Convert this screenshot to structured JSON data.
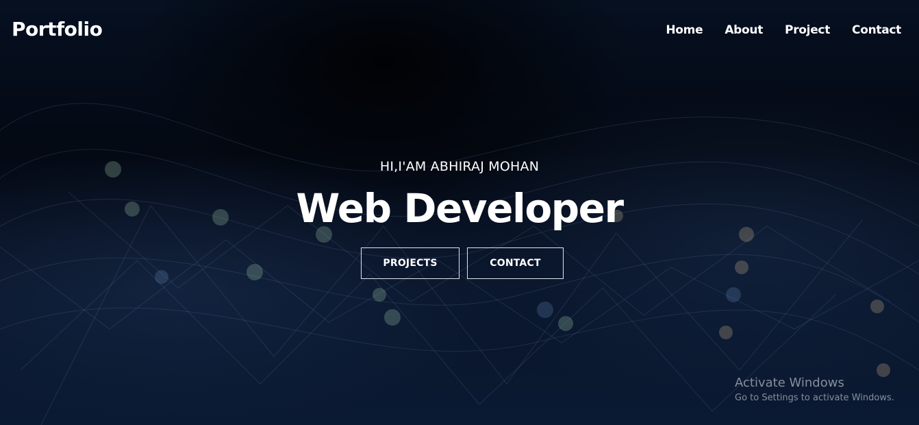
{
  "navbar": {
    "logo": "Portfolio",
    "links": [
      "Home",
      "About",
      "Project",
      "Contact"
    ]
  },
  "hero": {
    "subtitle": "HI,I'AM ABHIRAJ MOHAN",
    "title": "Web Developer",
    "buttons": {
      "projects": "PROJECTS",
      "contact": "CONTACT"
    }
  },
  "watermark": {
    "title": "Activate Windows",
    "subtitle": "Go to Settings to activate Windows."
  },
  "colors": {
    "background": "#050a14",
    "text": "#ffffff",
    "button_border": "#e0e6ee"
  }
}
